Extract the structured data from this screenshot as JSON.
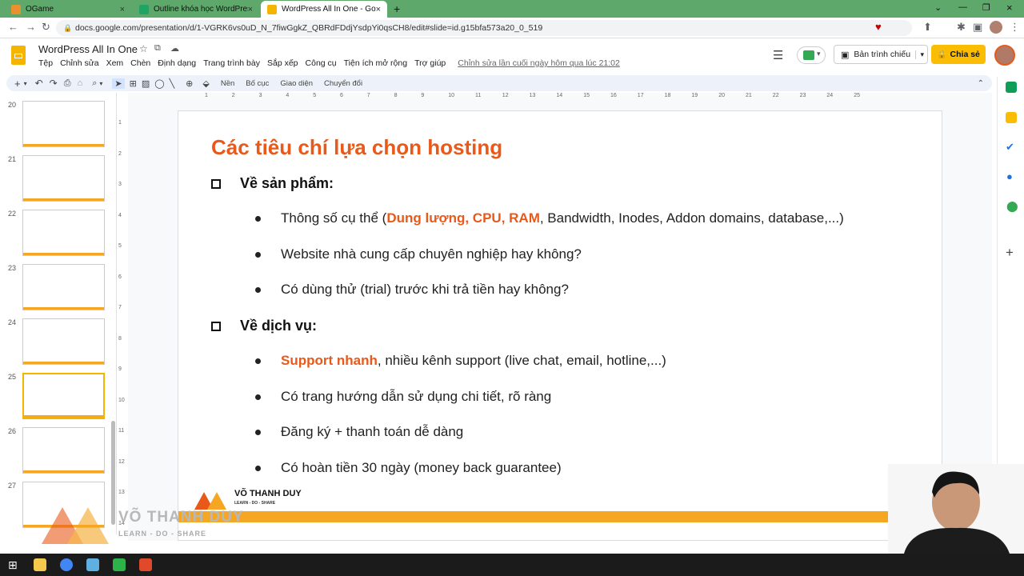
{
  "browser": {
    "tabs": [
      {
        "label": "OGame",
        "color": "#e8912d"
      },
      {
        "label": "Outline khóa học WordPress All In...",
        "color": "#1fa463"
      },
      {
        "label": "WordPress All In One - Google Trang...",
        "color": "#f4b400"
      }
    ],
    "new_tab": "+",
    "url": "docs.google.com/presentation/d/1-VGRK6vs0uD_N_7fiwGgkZ_QBRdFDdjYsdpYi0qsCH8/edit#slide=id.g15bfa573a20_0_519"
  },
  "app": {
    "title": "WordPress All In One",
    "menu": [
      "Tệp",
      "Chỉnh sửa",
      "Xem",
      "Chèn",
      "Định dạng",
      "Trang trình bày",
      "Sắp xếp",
      "Công cụ",
      "Tiện ích mở rộng",
      "Trợ giúp"
    ],
    "last_edit": "Chỉnh sửa lần cuối ngày hôm qua lúc 21:02",
    "present_label": "Bản trình chiếu",
    "share_label": "Chia sẻ"
  },
  "toolbar": {
    "background": "Nền",
    "layout": "Bố cục",
    "theme": "Giao diện",
    "transition": "Chuyển đổi"
  },
  "ruler": {
    "h_ticks": [
      "1",
      "2",
      "3",
      "4",
      "5",
      "6",
      "7",
      "8",
      "9",
      "10",
      "11",
      "12",
      "13",
      "14",
      "15",
      "16",
      "17",
      "18",
      "19",
      "20",
      "21",
      "22",
      "23",
      "24",
      "25"
    ],
    "v_ticks": [
      "1",
      "2",
      "3",
      "4",
      "5",
      "6",
      "7",
      "8",
      "9",
      "10",
      "11",
      "12",
      "13",
      "14"
    ]
  },
  "filmstrip": {
    "slides": [
      "20",
      "21",
      "22",
      "23",
      "24",
      "25",
      "26",
      "27"
    ],
    "selected": "25"
  },
  "slide": {
    "title": "Các tiêu chí lựa chọn hosting",
    "section1": "Về sản phẩm:",
    "b1_pre": "Thông số cụ thể (",
    "b1_hl": "Dung lượng, CPU, RAM",
    "b1_post": ", Bandwidth, Inodes, Addon domains, database,...)",
    "b2": "Website nhà cung cấp chuyên nghiệp hay không?",
    "b3": "Có dùng thử (trial) trước khi trả tiền hay không?",
    "section2": "Về dịch vụ:",
    "b4_hl": "Support nhanh",
    "b4_post": ", nhiều kênh support (live chat, email, hotline,...)",
    "b5": "Có trang hướng dẫn sử dụng chi tiết, rõ ràng",
    "b6": "Đăng ký + thanh toán dễ dàng",
    "b7": "Có hoàn tiền 30 ngày (money back guarantee)",
    "logo_name": "VÕ THANH DUY",
    "logo_tag": "LEARN - DO - SHARE"
  },
  "watermark": {
    "name": "VÕ THANH DUY",
    "tag": "LEARN - DO - SHARE"
  },
  "colors": {
    "accent": "#e8591a",
    "brand_band": "#f5a623",
    "tab_bar": "#5fa86b",
    "share": "#fbbc04"
  }
}
